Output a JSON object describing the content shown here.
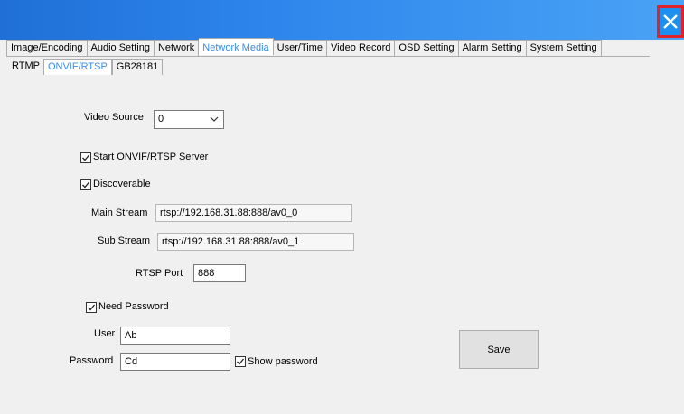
{
  "top_tabs": [
    {
      "label": "Image/Encoding",
      "active": false
    },
    {
      "label": "Audio Setting",
      "active": false
    },
    {
      "label": "Network",
      "active": false
    },
    {
      "label": "Network Media",
      "active": true
    },
    {
      "label": "User/Time",
      "active": false
    },
    {
      "label": "Video Record",
      "active": false
    },
    {
      "label": "OSD Setting",
      "active": false
    },
    {
      "label": "Alarm Setting",
      "active": false
    },
    {
      "label": "System Setting",
      "active": false
    }
  ],
  "sub_tabs": [
    {
      "label": "RTMP",
      "active": false
    },
    {
      "label": "ONVIF/RTSP",
      "active": true
    },
    {
      "label": "GB28181",
      "active": false
    }
  ],
  "form": {
    "video_source_label": "Video Source",
    "video_source_value": "0",
    "start_server_label": "Start ONVIF/RTSP Server",
    "start_server_checked": true,
    "discoverable_label": "Discoverable",
    "discoverable_checked": true,
    "main_stream_label": "Main Stream",
    "main_stream_value": "rtsp://192.168.31.88:888/av0_0",
    "sub_stream_label": "Sub Stream",
    "sub_stream_value": "rtsp://192.168.31.88:888/av0_1",
    "rtsp_port_label": "RTSP Port",
    "rtsp_port_value": "888",
    "need_password_label": "Need Password",
    "need_password_checked": true,
    "user_label": "User",
    "user_value": "Ab",
    "password_label": "Password",
    "password_value": "Cd",
    "show_password_label": "Show password",
    "show_password_checked": true,
    "save_label": "Save"
  },
  "colors": {
    "titlebar": "#2e86ec",
    "close_outline": "#e0222a",
    "active_tab_text": "#3c8ee6"
  }
}
